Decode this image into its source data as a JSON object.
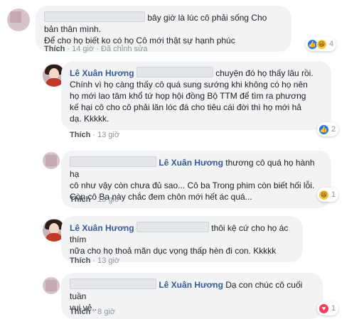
{
  "comments": [
    {
      "text": "bây giờ là lúc cô phải sống Cho bản thân mình. Để cho họ biết ko có họ Cô mới thật sự hạnh phúc",
      "line1": "bây giờ là lúc cô phải sống Cho bản thân mình.",
      "line2": "Để cho họ biết ko có họ Cô mới thật sự hạnh phúc",
      "like_label": "Thích",
      "time": "14 giờ",
      "edited": "Đã chỉnh sửa",
      "reaction_count": "4",
      "reactions": [
        "like-icon",
        "haha-icon"
      ]
    },
    {
      "author": "Lê Xuân Hương",
      "line1": "chuyện đó họ thấy lâu rồi.",
      "line2": "Chính vì họ càng thấy cô quá sung sướng khi không có họ nên",
      "line3": "họ mới lao tâm khổ tứ họp hội đồng Bộ TTM để tìm ra phương",
      "line4": "kế hại cô cho cô phải lăn lóc đá cho tiêu cái đời thì họ mới hả",
      "line5": "dạ. Kkkkk.",
      "like_label": "Thích",
      "time": "13 giờ",
      "reaction_count": "2",
      "reactions": [
        "like-icon"
      ]
    },
    {
      "author": "Lê Xuân Hương",
      "line1": "thương cô quá họ hành hạ",
      "line2": "cô như vậy còn chưa đủ sao... Cô ba Trong phim còn biết hối lỗi.",
      "line3": "Còn cô Ba này chắc đem chôn mới hết ác quá...",
      "like_label": "Thích",
      "time": "13 giờ",
      "reaction_count": "1",
      "reactions": [
        "haha-icon"
      ]
    },
    {
      "author": "Lê Xuân Hương",
      "line1": "thôi kệ cứ cho họ ác thím",
      "line2": "nữa cho họ thoả mãn dục vọng thấp hèn đi con. Kkkkk",
      "like_label": "Thích",
      "time": "13 giờ"
    },
    {
      "author": "Lê Xuân Hương",
      "line1": "Dạ con chúc cô cuối tuần",
      "line2": "vui vẻ..",
      "like_label": "Thích",
      "time": "8 giờ",
      "reaction_count": "1",
      "reactions": [
        "love-icon"
      ]
    }
  ],
  "separator": "·",
  "colors": {
    "name": "#385898",
    "bubble": "#f2f3f5",
    "like": "#1877f2",
    "love": "#f33e58",
    "haha": "#f7c53b"
  }
}
